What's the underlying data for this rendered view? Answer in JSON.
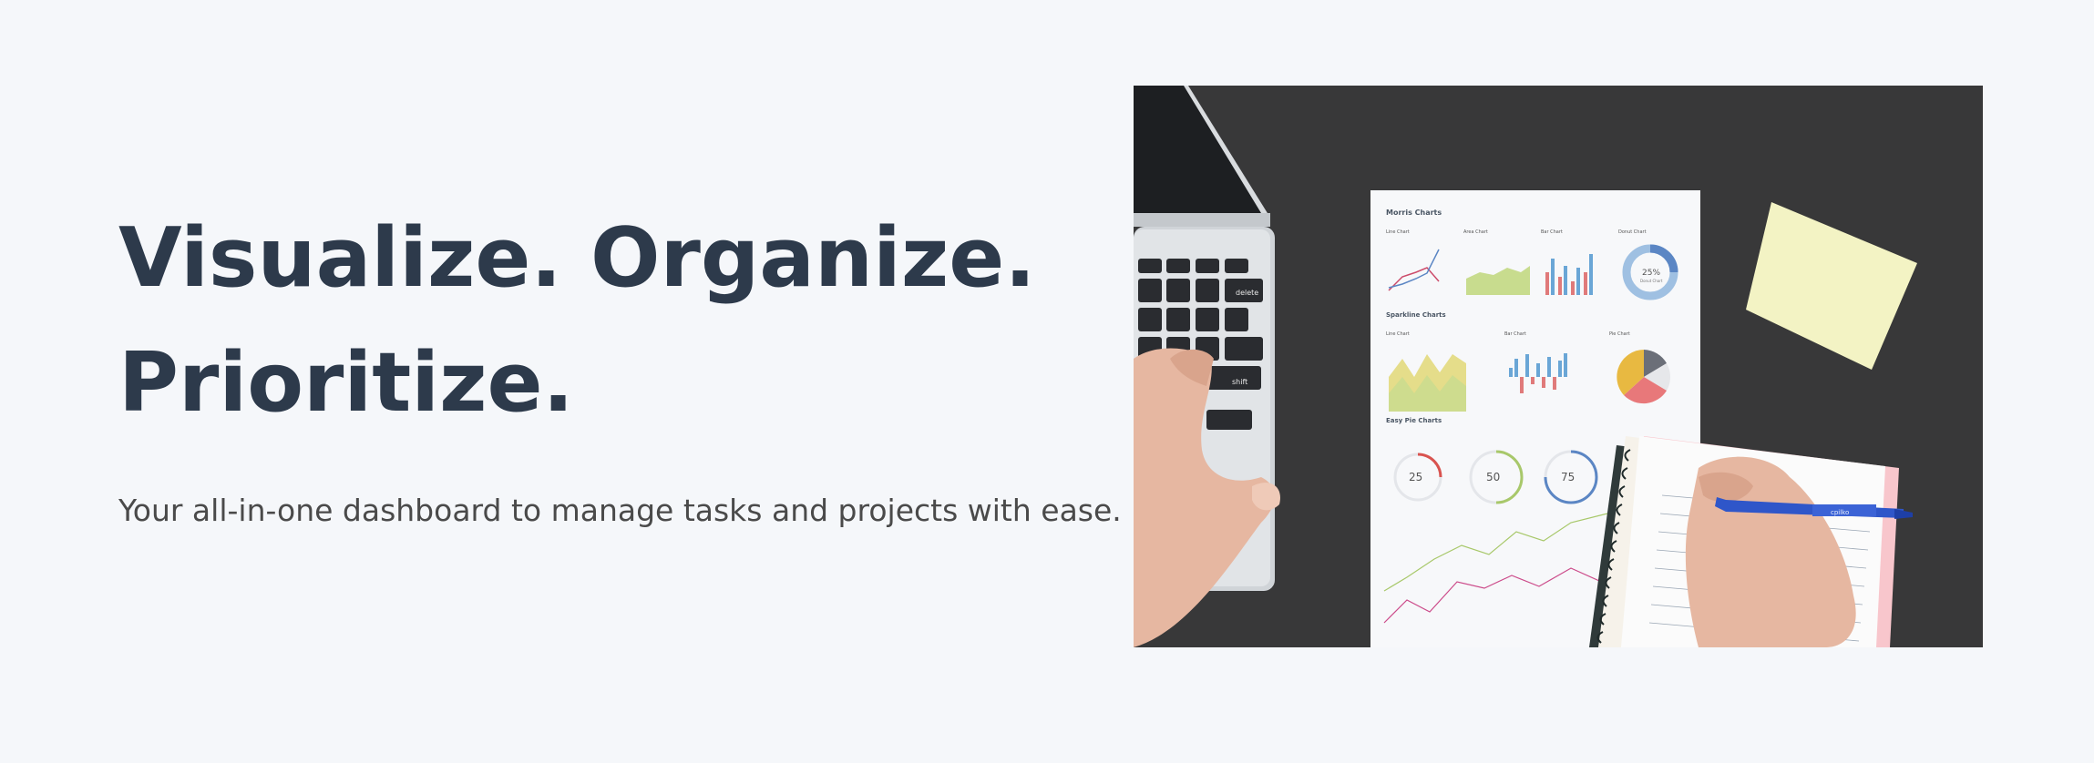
{
  "hero": {
    "title_line_1": "Visualize. Organize.",
    "title_line_2": "Prioritize.",
    "subtitle": "Your all-in-one dashboard to manage tasks and projects with ease."
  },
  "photo": {
    "sheet_title": "Morris Charts",
    "chart_labels": [
      "Line Chart",
      "Area Chart",
      "Bar Chart",
      "Donut Chart"
    ],
    "donut_value": "25%",
    "donut_caption": "Donut Chart",
    "section_2": "Sparkline Charts",
    "spark_labels": [
      "Line Chart",
      "Bar Chart",
      "Pie Chart"
    ],
    "section_3": "Easy Pie Charts",
    "pie_values": [
      "25",
      "50",
      "75"
    ],
    "pen_brand": "cpilko",
    "key_delete": "delete",
    "key_shift": "shift"
  },
  "colors": {
    "background": "#f5f7fa",
    "title": "#2d3a4b",
    "subtitle": "#4a4a4a",
    "desk": "#3a3a3c",
    "sticky_note": "#f3f3c4"
  }
}
